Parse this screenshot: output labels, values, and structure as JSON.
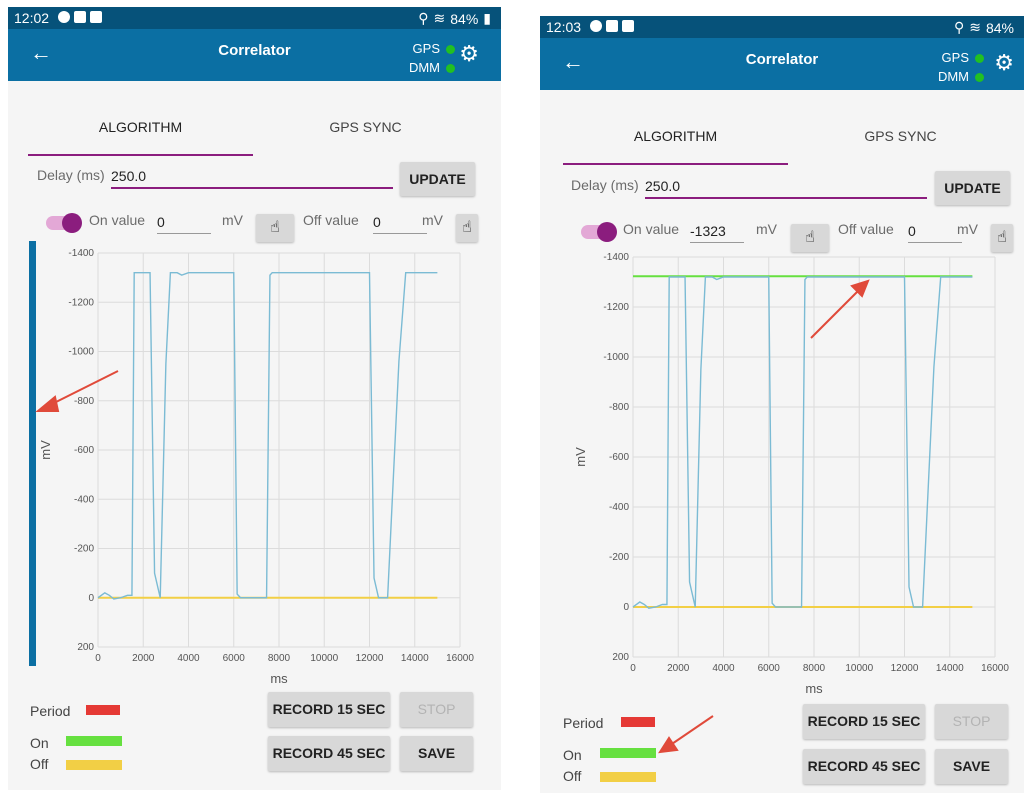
{
  "colors": {
    "toolbar": "#0b6fa3",
    "statusbar": "#06527a",
    "accent": "#8b1d7e",
    "period": "#e53935",
    "on": "#66e040",
    "off": "#f2cf45",
    "trace": "#7bbbd4",
    "status_dot": "#22c022",
    "annotation": "#e04a3a"
  },
  "left": {
    "status": {
      "time": "12:02",
      "battery": "84%"
    },
    "toolbar": {
      "back": "←",
      "title": "Correlator",
      "gps": "GPS",
      "dmm": "DMM",
      "gear": "⚙"
    },
    "tabs": {
      "algorithm": "ALGORITHM",
      "gps_sync": "GPS SYNC"
    },
    "delay": {
      "label": "Delay (ms)",
      "value": "250.0",
      "update": "UPDATE"
    },
    "onoff": {
      "on_label": "On value",
      "on_value": "0",
      "on_unit": "mV",
      "off_label": "Off value",
      "off_value": "0",
      "off_unit": "mV"
    },
    "legend": {
      "period": "Period",
      "on": "On",
      "off": "Off"
    },
    "buttons": {
      "record15": "RECORD 15 SEC",
      "stop": "STOP",
      "record45": "RECORD 45 SEC",
      "save": "SAVE"
    }
  },
  "right": {
    "status": {
      "time": "12:03",
      "battery": "84%"
    },
    "toolbar": {
      "back": "←",
      "title": "Correlator",
      "gps": "GPS",
      "dmm": "DMM",
      "gear": "⚙"
    },
    "tabs": {
      "algorithm": "ALGORITHM",
      "gps_sync": "GPS SYNC"
    },
    "delay": {
      "label": "Delay (ms)",
      "value": "250.0",
      "update": "UPDATE"
    },
    "onoff": {
      "on_label": "On value",
      "on_value": "-1323",
      "on_unit": "mV",
      "off_label": "Off value",
      "off_value": "0",
      "off_unit": "mV"
    },
    "legend": {
      "period": "Period",
      "on": "On",
      "off": "Off"
    },
    "buttons": {
      "record15": "RECORD 15 SEC",
      "stop": "STOP",
      "record45": "RECORD 45 SEC",
      "save": "SAVE"
    }
  },
  "chart_data": [
    {
      "type": "line",
      "xlabel": "ms",
      "ylabel": "mV",
      "xlim": [
        0,
        16000
      ],
      "ylim": [
        200,
        -1400
      ],
      "xticks": [
        "0",
        "2000",
        "4000",
        "6000",
        "8000",
        "10000",
        "12000",
        "14000",
        "16000"
      ],
      "yticks": [
        "-1400",
        "-1200",
        "-1000",
        "-800",
        "-600",
        "-400",
        "-200",
        "0",
        "200"
      ],
      "series": [
        {
          "key": "trace",
          "x": [
            0,
            300,
            500,
            700,
            1000,
            1300,
            1500,
            1600,
            1750,
            1900,
            2300,
            2500,
            2750,
            3000,
            3200,
            3500,
            3700,
            4000,
            6000,
            6150,
            6300,
            6600,
            7000,
            7450,
            7600,
            7700,
            8000,
            12000,
            12200,
            12400,
            12800,
            13300,
            13600,
            15000
          ],
          "y": [
            0,
            -20,
            -10,
            5,
            0,
            -10,
            -10,
            -1320,
            -1320,
            -1320,
            -1320,
            -100,
            0,
            -950,
            -1320,
            -1320,
            -1310,
            -1320,
            -1320,
            -15,
            0,
            0,
            0,
            0,
            -1310,
            -1320,
            -1320,
            -1320,
            -80,
            0,
            0,
            -960,
            -1320,
            -1320
          ]
        },
        {
          "key": "off",
          "x": [
            0,
            15000
          ],
          "y": [
            0,
            0
          ]
        }
      ]
    },
    {
      "type": "line",
      "xlabel": "ms",
      "ylabel": "mV",
      "xlim": [
        0,
        16000
      ],
      "ylim": [
        200,
        -1400
      ],
      "xticks": [
        "0",
        "2000",
        "4000",
        "6000",
        "8000",
        "10000",
        "12000",
        "14000",
        "16000"
      ],
      "yticks": [
        "-1400",
        "-1200",
        "-1000",
        "-800",
        "-600",
        "-400",
        "-200",
        "0",
        "200"
      ],
      "series": [
        {
          "key": "trace",
          "x": [
            0,
            300,
            500,
            700,
            1000,
            1300,
            1500,
            1600,
            1750,
            1900,
            2300,
            2500,
            2750,
            3000,
            3200,
            3500,
            3700,
            4000,
            6000,
            6150,
            6300,
            6600,
            7000,
            7450,
            7600,
            7700,
            8000,
            12000,
            12200,
            12400,
            12800,
            13300,
            13600,
            15000
          ],
          "y": [
            0,
            -20,
            -10,
            5,
            0,
            -10,
            -10,
            -1320,
            -1320,
            -1320,
            -1320,
            -100,
            0,
            -950,
            -1320,
            -1320,
            -1310,
            -1320,
            -1320,
            -15,
            0,
            0,
            0,
            0,
            -1310,
            -1320,
            -1320,
            -1320,
            -80,
            0,
            0,
            -960,
            -1320,
            -1320
          ]
        },
        {
          "key": "on",
          "x": [
            0,
            15000
          ],
          "y": [
            -1323,
            -1323
          ]
        },
        {
          "key": "off",
          "x": [
            0,
            15000
          ],
          "y": [
            0,
            0
          ]
        }
      ]
    }
  ]
}
